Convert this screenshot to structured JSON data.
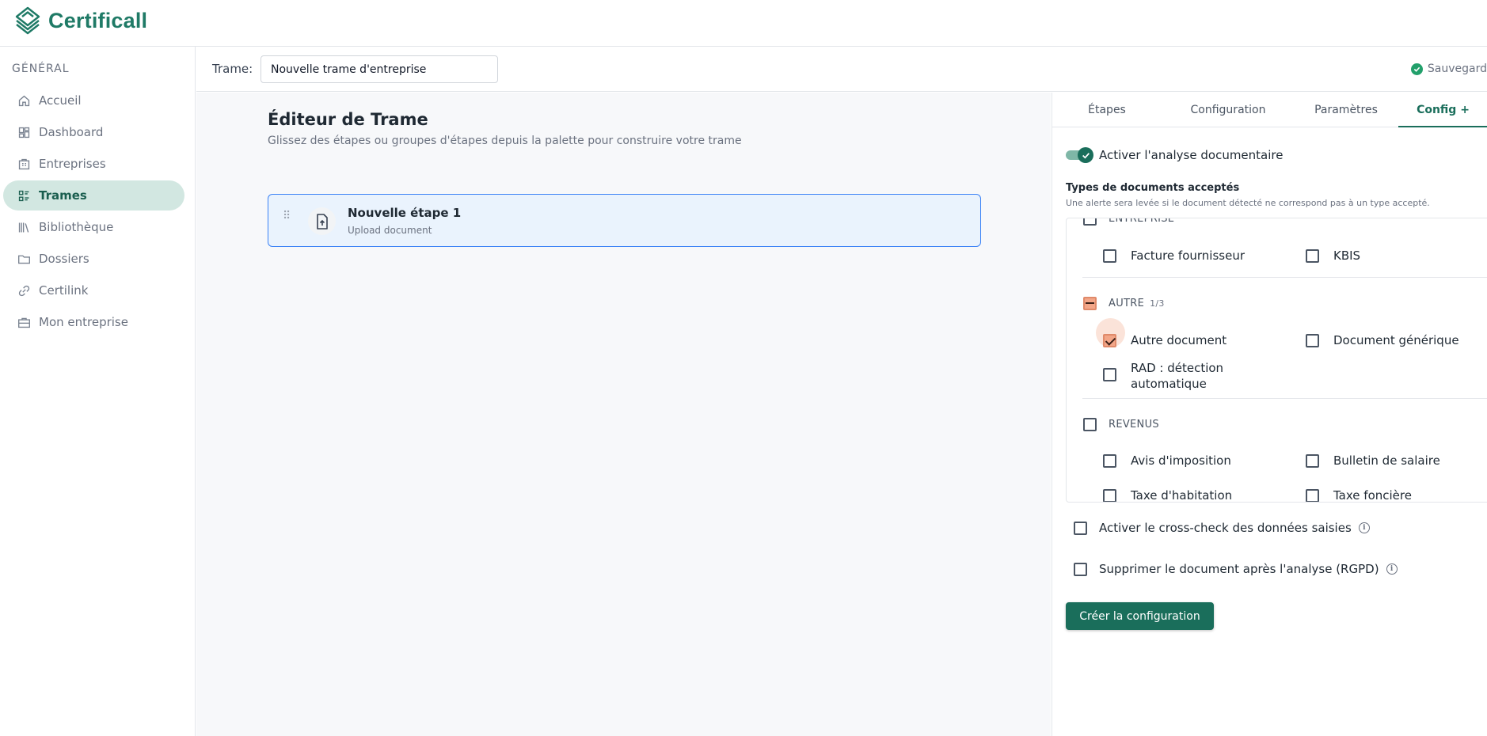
{
  "app": {
    "name": "Certificall"
  },
  "sidebar": {
    "section": "GÉNÉRAL",
    "items": [
      {
        "label": "Accueil",
        "icon": "home-icon",
        "active": false
      },
      {
        "label": "Dashboard",
        "icon": "dashboard-icon",
        "active": false
      },
      {
        "label": "Entreprises",
        "icon": "building-icon",
        "active": false
      },
      {
        "label": "Trames",
        "icon": "trames-icon",
        "active": true
      },
      {
        "label": "Bibliothèque",
        "icon": "library-icon",
        "active": false
      },
      {
        "label": "Dossiers",
        "icon": "folder-icon",
        "active": false
      },
      {
        "label": "Certilink",
        "icon": "link-icon",
        "active": false
      },
      {
        "label": "Mon entreprise",
        "icon": "briefcase-icon",
        "active": false
      }
    ]
  },
  "trame": {
    "label": "Trame:",
    "value": "Nouvelle trame d'entreprise",
    "status": "Sauvegard"
  },
  "editor": {
    "title": "Éditeur de Trame",
    "subtitle": "Glissez des étapes ou groupes d'étapes depuis la palette pour construire votre trame",
    "steps": [
      {
        "name": "Nouvelle étape 1",
        "type": "Upload document"
      }
    ]
  },
  "panel": {
    "tabs": [
      "Étapes",
      "Configuration",
      "Paramètres",
      "Config +"
    ],
    "active_tab": "Config +",
    "analysis_toggle": {
      "label": "Activer l'analyse documentaire",
      "on": true
    },
    "types_title": "Types de documents acceptés",
    "types_help": "Une alerte sera levée si le document détecté ne correspond pas à un type accepté.",
    "groups": [
      {
        "name": "ENTREPRISE",
        "state": "unchecked",
        "options": [
          {
            "label": "Facture fournisseur",
            "checked": false
          },
          {
            "label": "KBIS",
            "checked": false
          }
        ]
      },
      {
        "name": "AUTRE",
        "count": "1/3",
        "state": "indeterminate",
        "options": [
          {
            "label": "Autre document",
            "checked": true
          },
          {
            "label": "Document générique",
            "checked": false
          },
          {
            "label": "RAD : détection automatique",
            "checked": false
          }
        ]
      },
      {
        "name": "REVENUS",
        "state": "unchecked",
        "options": [
          {
            "label": "Avis d'imposition",
            "checked": false
          },
          {
            "label": "Bulletin de salaire",
            "checked": false
          },
          {
            "label": "Taxe d'habitation",
            "checked": false
          },
          {
            "label": "Taxe foncière",
            "checked": false
          }
        ]
      }
    ],
    "crosscheck_label": "Activer le cross-check des données saisies",
    "rgpd_label": "Supprimer le document après l'analyse (RGPD)",
    "create_button": "Créer la configuration"
  },
  "colors": {
    "brand": "#1a6e5b",
    "accent_checked": "#f3a688",
    "selected_step_border": "#3b82f6"
  }
}
